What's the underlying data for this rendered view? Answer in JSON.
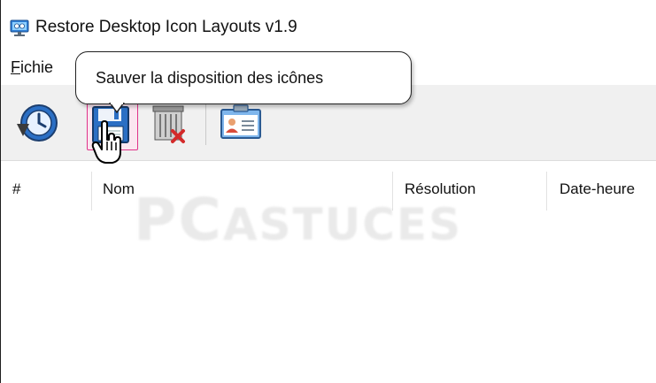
{
  "window": {
    "title": "Restore Desktop Icon Layouts v1.9",
    "icon": "monitor-app-icon"
  },
  "menu": {
    "file_label_accel": "F",
    "file_label_rest": "ichie"
  },
  "toolbar": {
    "buttons": [
      {
        "name": "restore-layout-button",
        "icon": "restore-clock-icon"
      },
      {
        "name": "save-layout-button",
        "icon": "floppy-save-icon",
        "state": "hover"
      },
      {
        "name": "delete-layout-button",
        "icon": "trash-delete-icon"
      },
      {
        "name": "properties-button",
        "icon": "id-card-icon"
      }
    ]
  },
  "tooltip": {
    "text": "Sauver la disposition des icônes"
  },
  "list": {
    "columns": [
      "#",
      "Nom",
      "Résolution",
      "Date-heure"
    ]
  },
  "watermark": {
    "part1": "PC",
    "part2": "ASTUCES"
  },
  "colors": {
    "hover_border": "#e0338a",
    "toolbar_bg": "#f0f0f0"
  }
}
